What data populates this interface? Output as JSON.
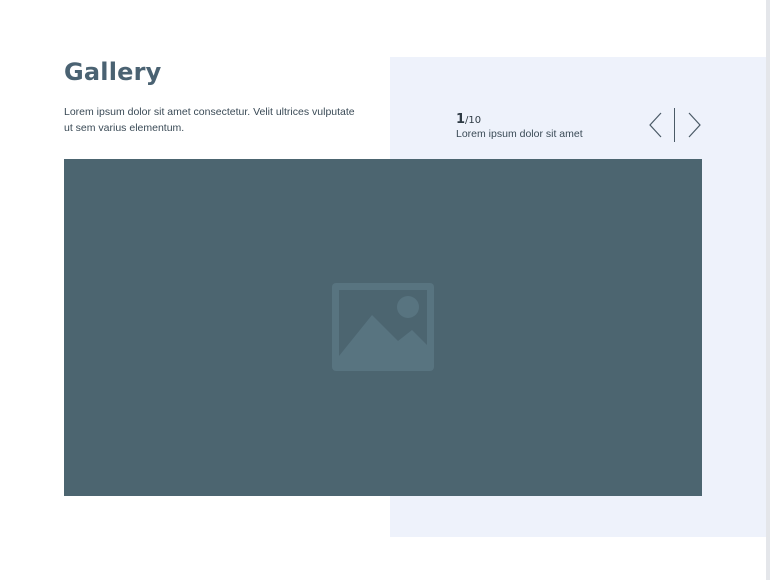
{
  "gallery": {
    "title": "Gallery",
    "description": "Lorem ipsum dolor sit amet consectetur. Velit ultrices vulputate ut sem varius elementum.",
    "current_slide": "1",
    "total_slides": "/10",
    "caption": "Lorem ipsum dolor sit amet"
  },
  "icons": {
    "prev": "chevron-left-icon",
    "next": "chevron-right-icon",
    "image": "image-placeholder-icon"
  },
  "colors": {
    "title": "#4a6272",
    "panel_bg": "#eef2fb",
    "image_bg": "#4c6570"
  }
}
